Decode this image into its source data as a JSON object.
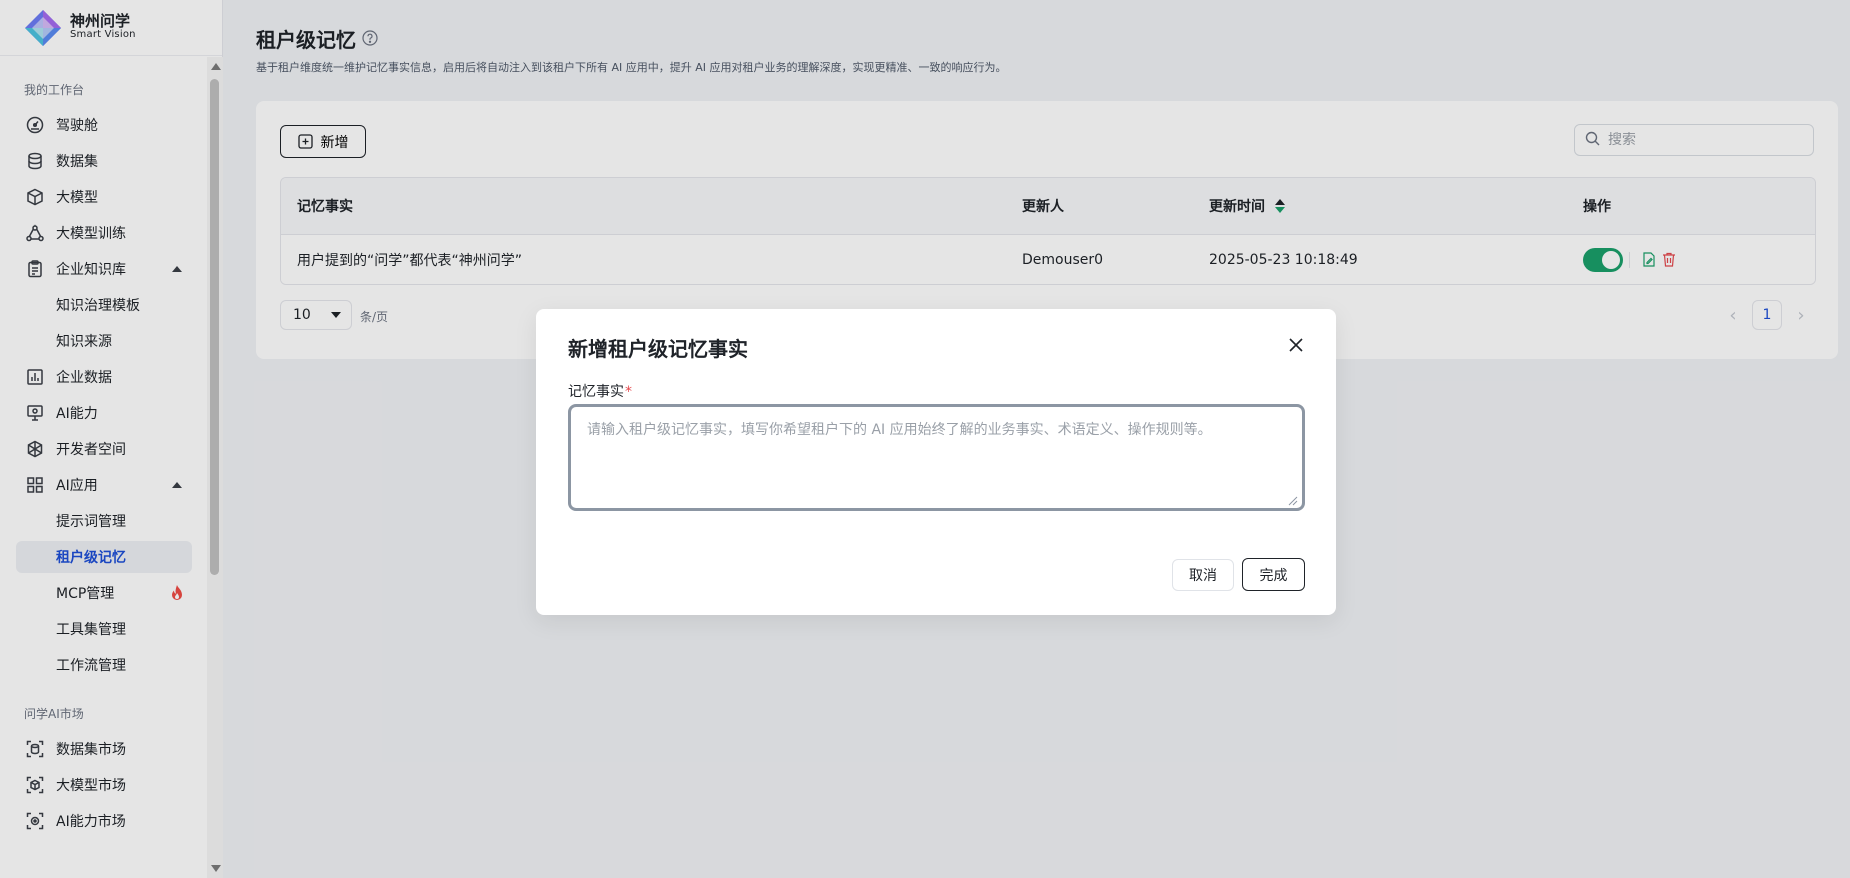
{
  "brand": {
    "name_cn": "神州问学",
    "name_en": "Smart Vision",
    "icon": "diamond-logo-icon"
  },
  "sidebar": {
    "section_workspace": "我的工作台",
    "section_market": "问学AI市场",
    "items": [
      {
        "label": "驾驶舱",
        "icon": "dashboard-icon"
      },
      {
        "label": "数据集",
        "icon": "database-icon"
      },
      {
        "label": "大模型",
        "icon": "cube-icon"
      },
      {
        "label": "大模型训练",
        "icon": "training-icon"
      },
      {
        "label": "企业知识库",
        "icon": "clipboard-icon",
        "expanded": true,
        "children": [
          {
            "label": "知识治理模板"
          },
          {
            "label": "知识来源"
          }
        ]
      },
      {
        "label": "企业数据",
        "icon": "bar-chart-icon"
      },
      {
        "label": "AI能力",
        "icon": "monitor-icon"
      },
      {
        "label": "开发者空间",
        "icon": "hexagon-icon"
      },
      {
        "label": "AI应用",
        "icon": "grid-icon",
        "expanded": true,
        "children": [
          {
            "label": "提示词管理"
          },
          {
            "label": "租户级记忆",
            "active": true
          },
          {
            "label": "MCP管理",
            "badge_icon": "fire-icon"
          },
          {
            "label": "工具集管理"
          },
          {
            "label": "工作流管理"
          }
        ]
      }
    ],
    "market_items": [
      {
        "label": "数据集市场",
        "icon": "dataset-market-icon"
      },
      {
        "label": "大模型市场",
        "icon": "model-market-icon"
      },
      {
        "label": "AI能力市场",
        "icon": "ai-market-icon"
      }
    ]
  },
  "page": {
    "title": "租户级记忆",
    "description": "基于租户维度统一维护记忆事实信息，启用后将自动注入到该租户下所有 AI 应用中，提升 AI 应用对租户业务的理解深度，实现更精准、一致的响应行为。"
  },
  "toolbar": {
    "add_label": "新增",
    "search_placeholder": "搜索"
  },
  "table": {
    "columns": [
      "记忆事实",
      "更新人",
      "更新时间",
      "操作"
    ],
    "rows": [
      {
        "fact": "用户提到的“问学”都代表“神州问学”",
        "updater": "Demouser0",
        "updated_at": "2025-05-23 10:18:49",
        "enabled": true
      }
    ]
  },
  "pagination": {
    "page_size": "10",
    "unit": "条/页",
    "current_page": "1"
  },
  "modal": {
    "title": "新增租户级记忆事实",
    "field_label": "记忆事实",
    "required_mark": "*",
    "placeholder": "请输入租户级记忆事实，填写你希望租户下的 AI 应用始终了解的业务事实、术语定义、操作规则等。",
    "cancel_label": "取消",
    "ok_label": "完成"
  },
  "colors": {
    "accent": "#1d4fd7",
    "success": "#1aa06a",
    "danger": "#e5484d"
  }
}
